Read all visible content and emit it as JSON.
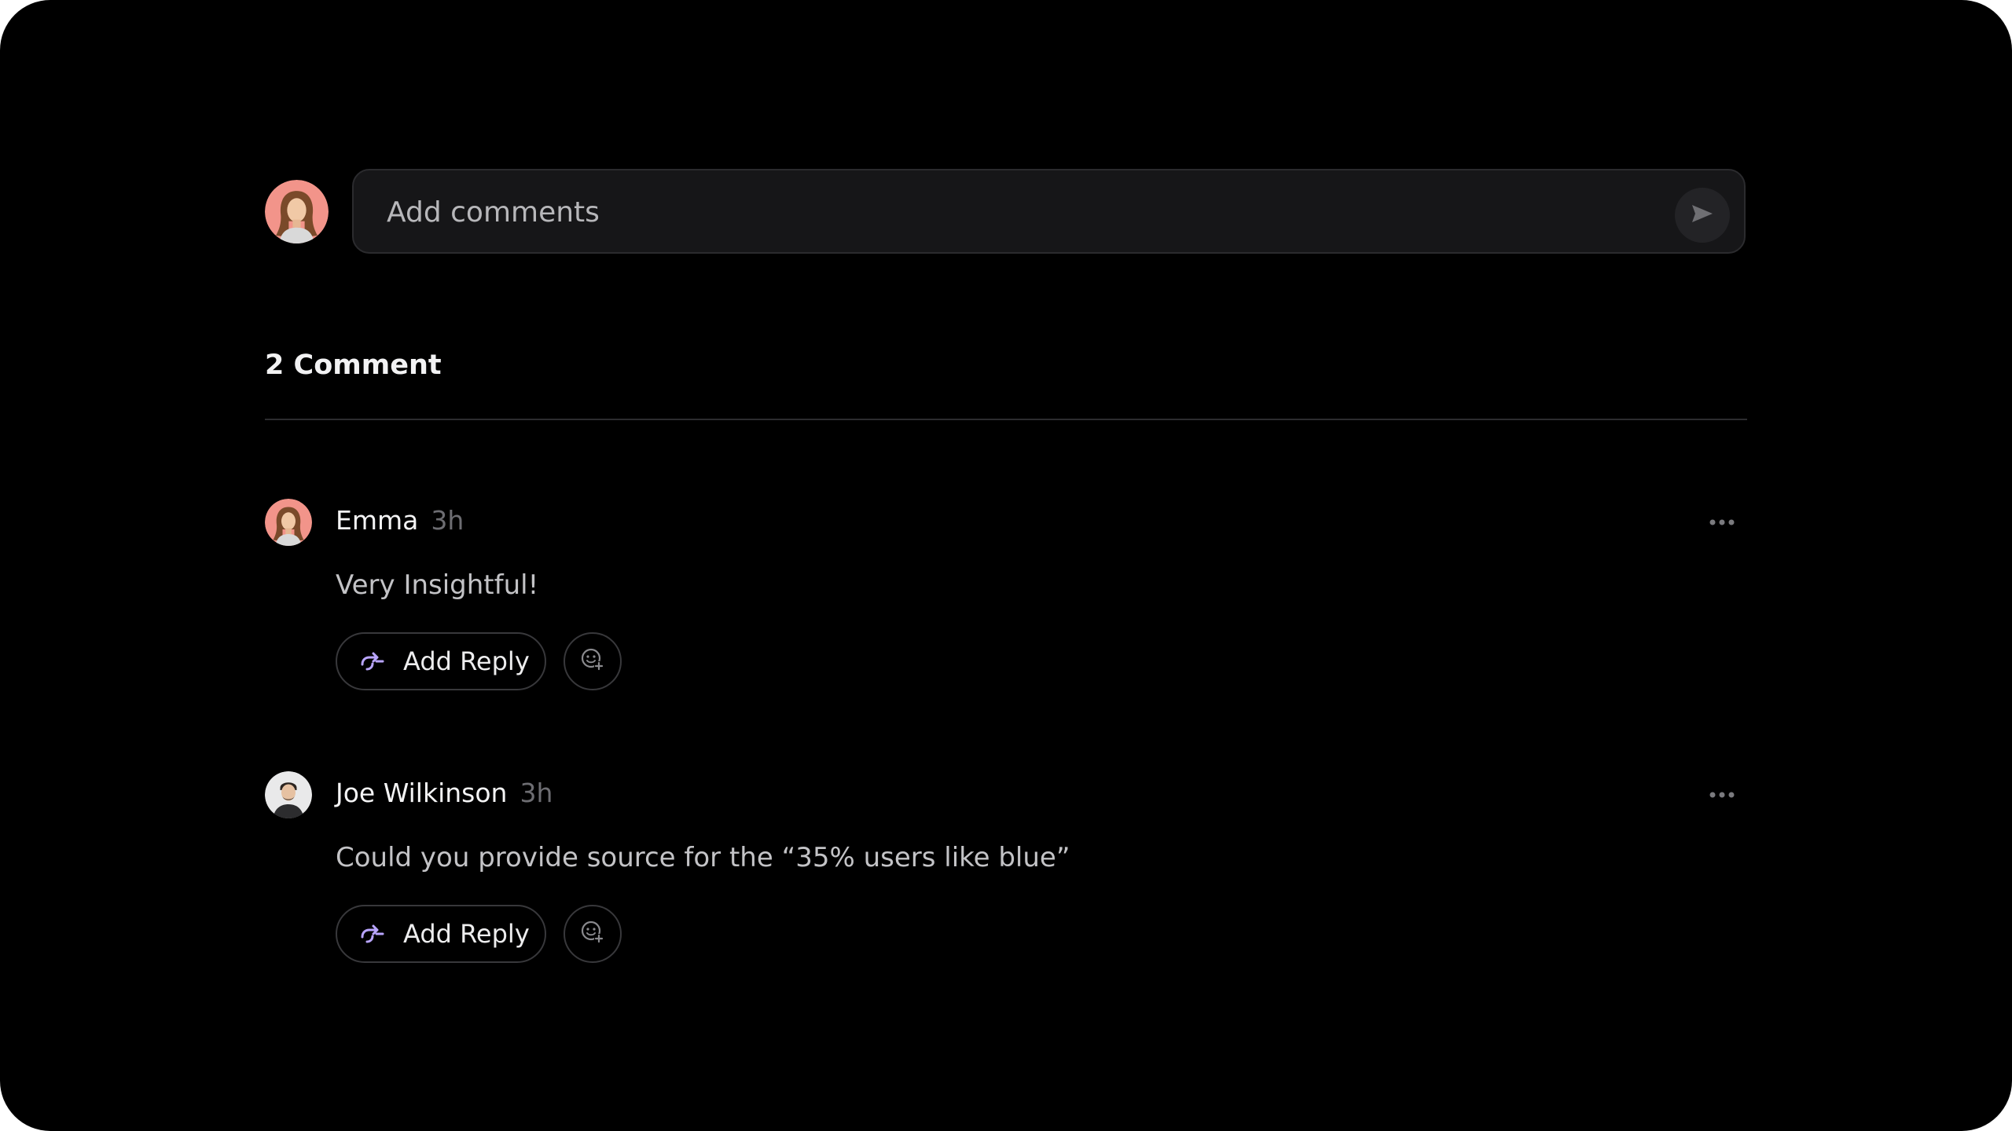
{
  "composer": {
    "placeholder": "Add comments",
    "send_icon": "send-icon"
  },
  "header": {
    "comment_count_label": "2 Comment"
  },
  "comments": [
    {
      "author": "Emma",
      "time": "3h",
      "text": "Very Insightful!",
      "reply_label": "Add Reply",
      "avatar": "avatar-emma"
    },
    {
      "author": "Joe Wilkinson",
      "time": "3h",
      "text": "Could you provide source for the “35% users like blue”",
      "reply_label": "Add Reply",
      "avatar": "avatar-joe"
    }
  ],
  "colors": {
    "background": "#000000",
    "input_bg": "#161618",
    "reply_icon": "#b9a5ff",
    "muted_text": "#6d6d72"
  }
}
